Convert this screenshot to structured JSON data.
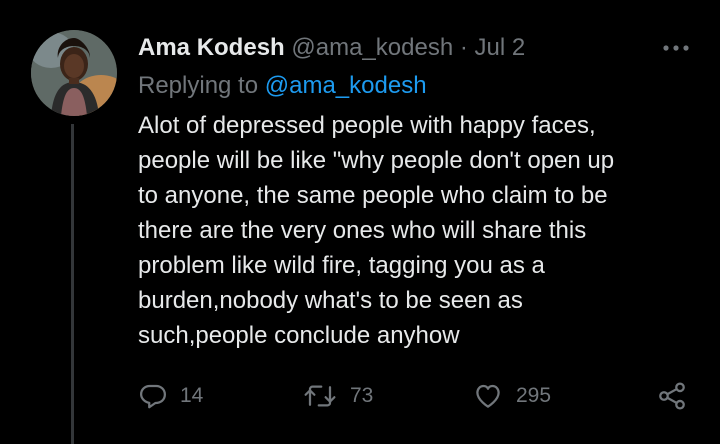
{
  "tweet": {
    "author_name": "Ama Kodesh",
    "author_handle": "@ama_kodesh",
    "separator": "·",
    "date": "Jul 2",
    "replying_to_label": "Replying to",
    "replying_to_handle": "@ama_kodesh",
    "text_lines": [
      "Alot of depressed people with happy faces,",
      "people will be like \"why people don't open up",
      "to anyone, the same people who claim to be",
      "there are the very ones who will share this",
      "problem like wild fire, tagging you as a",
      "burden,nobody what's to be seen as",
      "such,people conclude anyhow"
    ],
    "metrics": {
      "replies": "14",
      "retweets": "73",
      "likes": "295"
    }
  },
  "icons": {
    "more": "more-icon",
    "reply": "reply-icon",
    "retweet": "retweet-icon",
    "like": "heart-icon",
    "share": "share-icon"
  },
  "colors": {
    "background": "#000000",
    "text_primary": "#e7e9ea",
    "text_secondary": "#71767b",
    "link": "#1d9bf0",
    "thread_line": "#333639"
  }
}
